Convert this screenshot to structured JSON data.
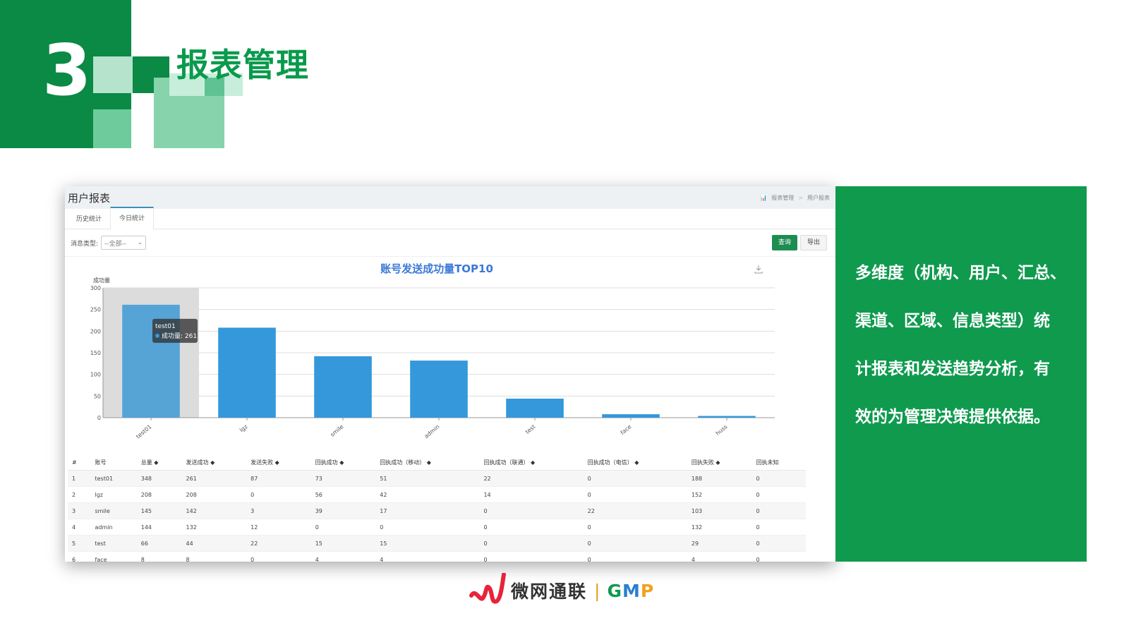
{
  "slide": {
    "section_number": "3",
    "section_title": "报表管理"
  },
  "app": {
    "page_title": "用户报表",
    "breadcrumb": [
      "报表管理",
      "用户报表"
    ],
    "tabs": [
      {
        "label": "历史统计",
        "active": false
      },
      {
        "label": "今日统计",
        "active": true
      }
    ],
    "filter": {
      "label": "消息类型:",
      "selected": "--全部--"
    },
    "buttons": {
      "query": "查询",
      "export": "导出"
    }
  },
  "chart_data": {
    "type": "bar",
    "title": "账号发送成功量TOP10",
    "ylabel": "成功量",
    "categories": [
      "test01",
      "lgz",
      "smile",
      "admin",
      "test",
      "face",
      "huss"
    ],
    "series": [
      {
        "name": "成功量",
        "values": [
          261,
          208,
          142,
          132,
          44,
          8,
          4
        ]
      }
    ],
    "ylim": [
      0,
      300
    ],
    "yticks": [
      0,
      50,
      100,
      150,
      200,
      250,
      300
    ],
    "highlight_index": 0,
    "tooltip": {
      "title": "test01",
      "label": "成功量",
      "value": "261"
    },
    "colors": {
      "bar": "#3498db",
      "bar_highlight": "#56a3d6",
      "title": "#3b78d8"
    }
  },
  "table": {
    "headers": [
      "#",
      "账号",
      "总量",
      "发送成功",
      "发送失败",
      "回执成功",
      "回执成功（移动）",
      "回执成功（联通）",
      "回执成功（电信）",
      "回执失败",
      "回执未知"
    ],
    "rows": [
      [
        "1",
        "test01",
        "348",
        "261",
        "87",
        "73",
        "51",
        "22",
        "0",
        "188",
        "0"
      ],
      [
        "2",
        "lgz",
        "208",
        "208",
        "0",
        "56",
        "42",
        "14",
        "0",
        "152",
        "0"
      ],
      [
        "3",
        "smile",
        "145",
        "142",
        "3",
        "39",
        "17",
        "0",
        "22",
        "103",
        "0"
      ],
      [
        "4",
        "admin",
        "144",
        "132",
        "12",
        "0",
        "0",
        "0",
        "0",
        "132",
        "0"
      ],
      [
        "5",
        "test",
        "66",
        "44",
        "22",
        "15",
        "15",
        "0",
        "0",
        "29",
        "0"
      ],
      [
        "6",
        "face",
        "8",
        "8",
        "0",
        "4",
        "4",
        "0",
        "0",
        "4",
        "0"
      ]
    ]
  },
  "info": {
    "lines": [
      "多维度（机构、用户、汇总、",
      "渠道、区域、信息类型）统",
      "计报表和发送趋势分析，有",
      "效的为管理决策提供依据。"
    ]
  },
  "footer": {
    "brand": "微网通联",
    "separator": "|",
    "gmp": [
      "G",
      "M",
      "P"
    ],
    "colors": {
      "mark": "#e6243b",
      "G": "#0f9a4e",
      "M": "#2d7fd1",
      "P": "#f0a21d"
    }
  }
}
